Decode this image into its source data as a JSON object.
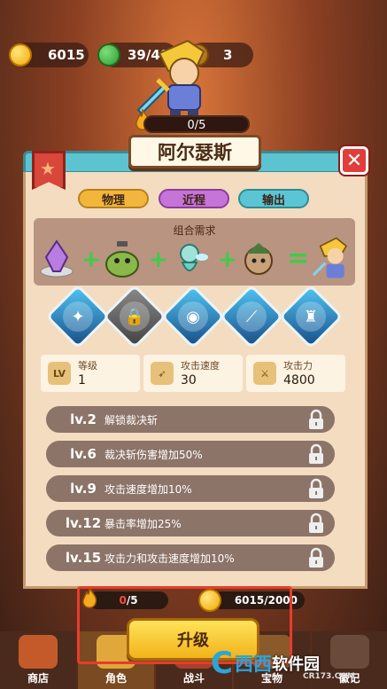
{
  "resources": [
    {
      "icon": "coin-icon",
      "value": "6015"
    },
    {
      "icon": "gem-icon",
      "value": "39/40"
    },
    {
      "icon": "gold-icon",
      "value": "3"
    }
  ],
  "hero_xp": "0/5",
  "hero_name": "阿尔瑟斯",
  "tags": [
    "物理",
    "近程",
    "输出"
  ],
  "combo": {
    "title": "组合需求",
    "items": [
      "crystal-icon",
      "green-orc-icon",
      "fairy-icon",
      "goblin-icon",
      "hero-knight-icon"
    ]
  },
  "skills": [
    {
      "name": "skill-shadow-icon",
      "locked": false
    },
    {
      "name": "lock-icon",
      "locked": true
    },
    {
      "name": "skill-spirit-icon",
      "locked": false
    },
    {
      "name": "skill-slash-icon",
      "locked": false
    },
    {
      "name": "skill-armor-icon",
      "locked": false
    }
  ],
  "stats": [
    {
      "icon_text": "LV",
      "label": "等级",
      "value": "1"
    },
    {
      "icon_text": "",
      "label": "攻击速度",
      "value": "30"
    },
    {
      "icon_text": "",
      "label": "攻击力",
      "value": "4800"
    }
  ],
  "levels": [
    {
      "lv": "lv.2",
      "desc": "解锁裁决斩"
    },
    {
      "lv": "lv.6",
      "desc": "裁决斩伤害增加50%"
    },
    {
      "lv": "lv.9",
      "desc": "攻击速度增加10%"
    },
    {
      "lv": "lv.12",
      "desc": "暴击率增加25%"
    },
    {
      "lv": "lv.15",
      "desc": "攻击力和攻击速度增加10%"
    }
  ],
  "upgrade_cost": {
    "flame_current": "0",
    "flame_total": "/5",
    "coin": "6015/2000"
  },
  "upgrade_label": "升级",
  "nav": [
    "商店",
    "角色",
    "战斗",
    "宝物",
    "徽记"
  ],
  "watermark": {
    "brand1": "西西",
    "brand2": "软件园",
    "site": "CR173.COM"
  },
  "colors": {
    "accent": "#5cc3d0",
    "close": "#e23d3a",
    "button": "#f2b31a",
    "highlight_frame": "#e73c2d"
  }
}
